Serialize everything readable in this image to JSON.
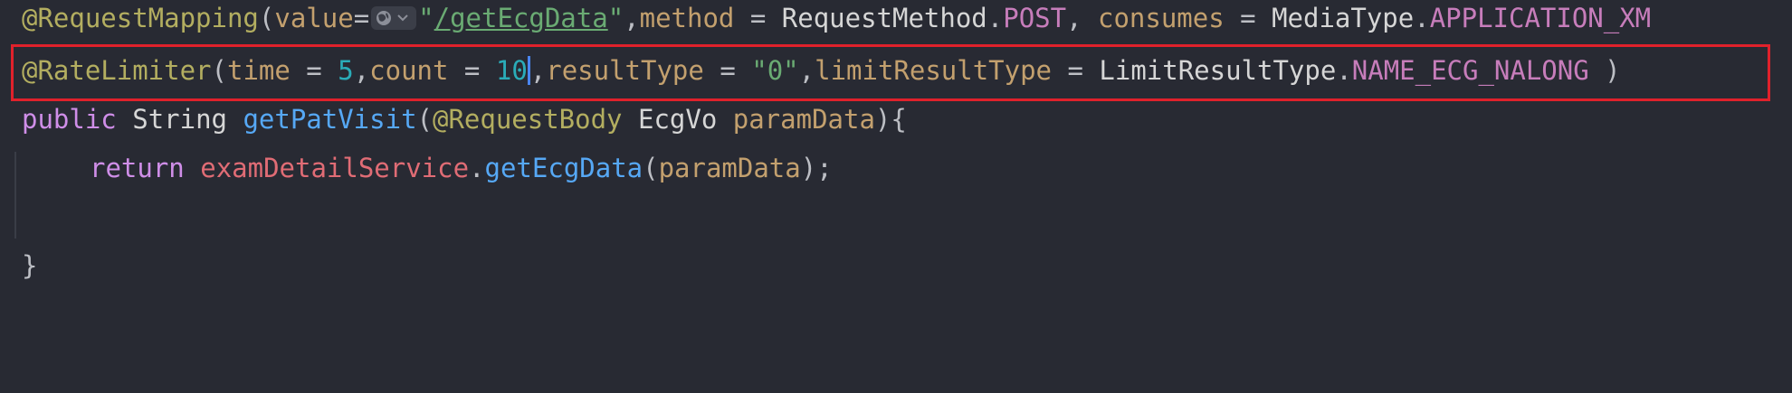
{
  "code": {
    "line1": {
      "annotation": "@RequestMapping",
      "open": "(",
      "value_key": "value",
      "value_eq": "=",
      "quote_open": "\"",
      "url": "/getEcgData",
      "quote_close": "\"",
      "sep1": ",",
      "method_key": "method",
      "method_eq": " = ",
      "method_type": "RequestMethod",
      "dot1": ".",
      "method_val": "POST",
      "sep2": ", ",
      "consumes_key": "consumes",
      "consumes_eq": " = ",
      "media_type": "MediaType",
      "dot2": ".",
      "media_val": "APPLICATION_XM"
    },
    "line2": {
      "annotation": "@RateLimiter",
      "open": "(",
      "time_key": "time",
      "time_eq": " = ",
      "time_val": "5",
      "sep1": ",",
      "count_key": "count",
      "count_eq": " = ",
      "count_val": "10",
      "sep2": ",",
      "rt_key": "resultType",
      "rt_eq": " = ",
      "rt_val": "\"0\"",
      "sep3": ",",
      "lrt_key": "limitResultType",
      "lrt_eq": " = ",
      "lrt_type": "LimitResultType",
      "dot": ".",
      "lrt_val": "NAME_ECG_NALONG",
      "close": " )"
    },
    "line3": {
      "kw_public": "public",
      "type_string": "String",
      "method_name": "getPatVisit",
      "open": "(",
      "ann": "@RequestBody",
      "param_type": "EcgVo",
      "param_name": "paramData",
      "close": "){"
    },
    "line4": {
      "kw_return": "return",
      "service": "examDetailService",
      "dot": ".",
      "call": "getEcgData",
      "open": "(",
      "arg": "paramData",
      "close": ");"
    },
    "line6": {
      "brace": "}"
    }
  },
  "icons": {
    "inlay": "globe-icon",
    "inlay_chevron": "chevron-down-icon"
  },
  "colors": {
    "background": "#282a33",
    "highlight_border": "#e0212b",
    "caret": "#4a86f0"
  }
}
